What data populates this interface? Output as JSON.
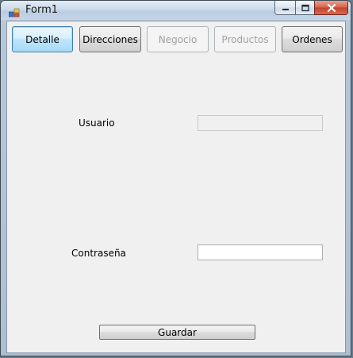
{
  "window": {
    "title": "Form1",
    "icon": "form-app-icon",
    "controls": [
      "minimize-icon",
      "maximize-icon",
      "close-icon"
    ]
  },
  "toolbar": {
    "tabs": [
      {
        "label": "Detalle",
        "state": "focused"
      },
      {
        "label": "Direcciones",
        "state": "normal"
      },
      {
        "label": "Negocio",
        "state": "disabled"
      },
      {
        "label": "Productos",
        "state": "disabled"
      },
      {
        "label": "Ordenes",
        "state": "normal"
      }
    ]
  },
  "form": {
    "usuario_label": "Usuario",
    "usuario_value": "",
    "contrasena_label": "Contraseña",
    "contrasena_value": "",
    "save_label": "Guardar"
  },
  "colors": {
    "accent_close": "#c3412a",
    "focus_border": "#3c7fb1",
    "client_background": "#f0f0f0"
  }
}
